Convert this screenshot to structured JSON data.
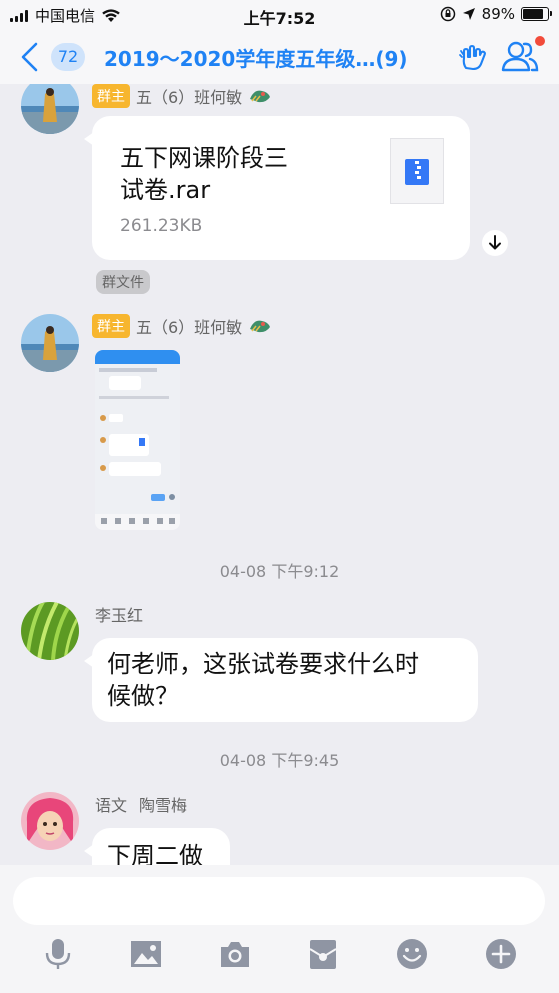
{
  "status_bar": {
    "carrier": "中国电信",
    "time": "上午7:52",
    "battery": "89%",
    "battery_level": 0.89
  },
  "header": {
    "unread_count": "72",
    "title": "2019～2020学年度五年级…(9)"
  },
  "messages": [
    {
      "type": "file",
      "sender_role": "群主",
      "sender_name": "五（6）班何敏",
      "file_name_line1": "五下网课阶段三",
      "file_name_line2": "试卷.rar",
      "file_size": "261.23KB",
      "tag": "群文件"
    },
    {
      "type": "image",
      "sender_role": "群主",
      "sender_name": "五（6）班何敏"
    },
    {
      "type": "timestamp",
      "text": "04-08 下午9:12"
    },
    {
      "type": "text",
      "sender_name": "李玉红",
      "line1": "何老师，这张试卷要求什么时",
      "line2": "候做？"
    },
    {
      "type": "timestamp",
      "text": "04-08 下午9:45"
    },
    {
      "type": "text",
      "sender_label": "语文",
      "sender_name": "陶雪梅",
      "line1": "下周二做"
    }
  ],
  "icons": {
    "back": "chevron-left-icon",
    "hand": "rock-hand-icon",
    "members": "group-members-icon",
    "voice": "microphone-icon",
    "image": "image-icon",
    "camera": "camera-icon",
    "redpacket": "red-packet-icon",
    "emoji": "emoji-icon",
    "more": "plus-icon"
  },
  "colors": {
    "accent": "#1f82f4",
    "badge": "#f7b62f",
    "unread_dot": "#f24b3b",
    "background": "#ededf2"
  }
}
